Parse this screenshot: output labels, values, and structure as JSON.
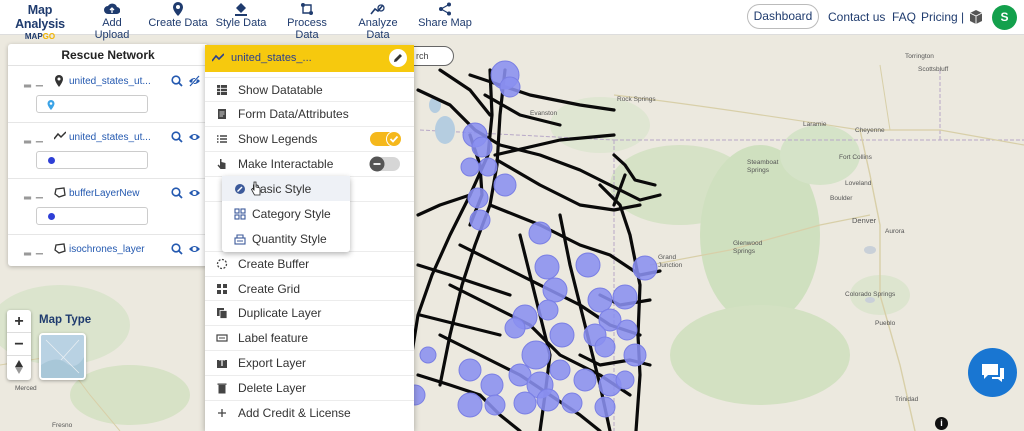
{
  "brand": {
    "title": "Map Analysis",
    "sub_left": "MAP",
    "sub_right": "GO"
  },
  "nav": [
    {
      "label": "Add Upload",
      "icon": "cloud-upload-icon"
    },
    {
      "label": "Create Data",
      "icon": "location-pin-icon"
    },
    {
      "label": "Style Data",
      "icon": "paint-bucket-icon"
    },
    {
      "label": "Process Data",
      "icon": "process-icon"
    },
    {
      "label": "Analyze Data",
      "icon": "analyze-icon"
    },
    {
      "label": "Share Map",
      "icon": "share-icon"
    }
  ],
  "header_right": {
    "dashboard": "Dashboard",
    "contact": "Contact us",
    "faq": "FAQ",
    "pricing": "Pricing |",
    "avatar_initial": "S"
  },
  "panel": {
    "title": "Rescue Network",
    "layers": [
      {
        "name": "united_states_ut...",
        "type_icon": "point-layer-icon",
        "visible": false
      },
      {
        "name": "united_states_ut...",
        "type_icon": "line-layer-icon",
        "visible": true
      },
      {
        "name": "bufferLayerNew",
        "type_icon": "polygon-layer-icon",
        "visible": true
      },
      {
        "name": "isochrones_layer",
        "type_icon": "polygon-layer-icon",
        "visible": true
      }
    ]
  },
  "search": {
    "partial_text": "rch"
  },
  "menu": {
    "layer_name": "united_states_...",
    "items": [
      {
        "label": "Show Datatable",
        "icon": "table-icon"
      },
      {
        "label": "Form Data/Attributes",
        "icon": "form-icon"
      },
      {
        "label": "Show Legends",
        "icon": "list-icon",
        "toggle": true
      },
      {
        "label": "Make Interactable",
        "icon": "pointer-icon",
        "toggle": false
      },
      {
        "label": "Create Buffer",
        "icon": "buffer-icon"
      },
      {
        "label": "Create Grid",
        "icon": "grid-icon"
      },
      {
        "label": "Duplicate Layer",
        "icon": "copy-icon"
      },
      {
        "label": "Label feature",
        "icon": "label-icon"
      },
      {
        "label": "Export Layer",
        "icon": "export-icon"
      },
      {
        "label": "Delete Layer",
        "icon": "trash-icon"
      },
      {
        "label": "Add Credit & License",
        "icon": "plus-icon"
      }
    ],
    "submenu": [
      {
        "label": "Basic Style",
        "icon": "basic-style-icon"
      },
      {
        "label": "Category Style",
        "icon": "category-style-icon"
      },
      {
        "label": "Quantity Style",
        "icon": "quantity-style-icon"
      }
    ]
  },
  "map_type_label": "Map Type",
  "map_labels": [
    "Torrington",
    "Scottsbluff",
    "Rock Springs",
    "Evanston",
    "Laramie",
    "Cheyenne",
    "Fort Collins",
    "Steamboat Springs",
    "Loveland",
    "Boulder",
    "Denver",
    "Aurora",
    "Grand Junction",
    "Glenwood Springs",
    "Colorado Springs",
    "Pueblo",
    "Trinidad",
    "Merced",
    "Fresno"
  ],
  "colors": {
    "accent": "#f6c90e",
    "brand": "#1f3b6e",
    "circle": "#8a8ff0",
    "toggle_on": "#f5b81c",
    "chat": "#1976d2",
    "avatar": "#13a04c"
  }
}
